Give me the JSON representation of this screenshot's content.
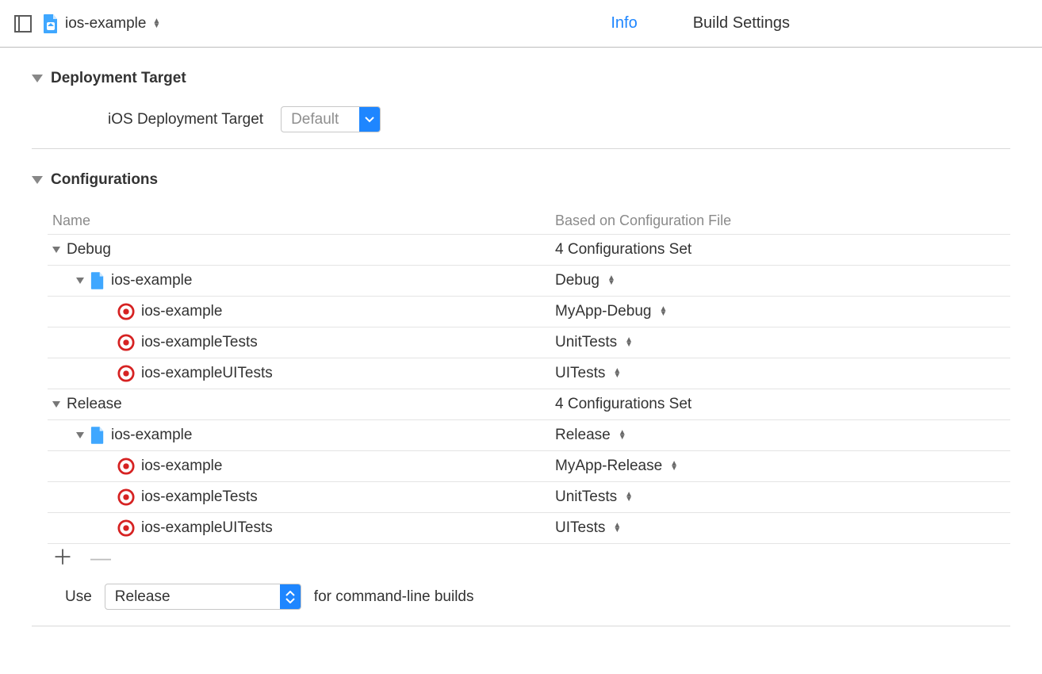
{
  "topbar": {
    "project_name": "ios-example",
    "tabs": {
      "info": "Info",
      "build_settings": "Build Settings"
    }
  },
  "deployment": {
    "section_title": "Deployment Target",
    "label": "iOS Deployment Target",
    "value": "Default"
  },
  "configurations": {
    "section_title": "Configurations",
    "columns": {
      "name": "Name",
      "based": "Based on Configuration File"
    },
    "groups": [
      {
        "name": "Debug",
        "summary": "4 Configurations Set",
        "project": {
          "name": "ios-example",
          "config": "Debug"
        },
        "targets": [
          {
            "name": "ios-example",
            "config": "MyApp-Debug"
          },
          {
            "name": "ios-exampleTests",
            "config": "UnitTests"
          },
          {
            "name": "ios-exampleUITests",
            "config": "UITests"
          }
        ]
      },
      {
        "name": "Release",
        "summary": "4 Configurations Set",
        "project": {
          "name": "ios-example",
          "config": "Release"
        },
        "targets": [
          {
            "name": "ios-example",
            "config": "MyApp-Release"
          },
          {
            "name": "ios-exampleTests",
            "config": "UnitTests"
          },
          {
            "name": "ios-exampleUITests",
            "config": "UITests"
          }
        ]
      }
    ],
    "use_label": "Use",
    "use_value": "Release",
    "use_suffix": "for command-line builds"
  }
}
